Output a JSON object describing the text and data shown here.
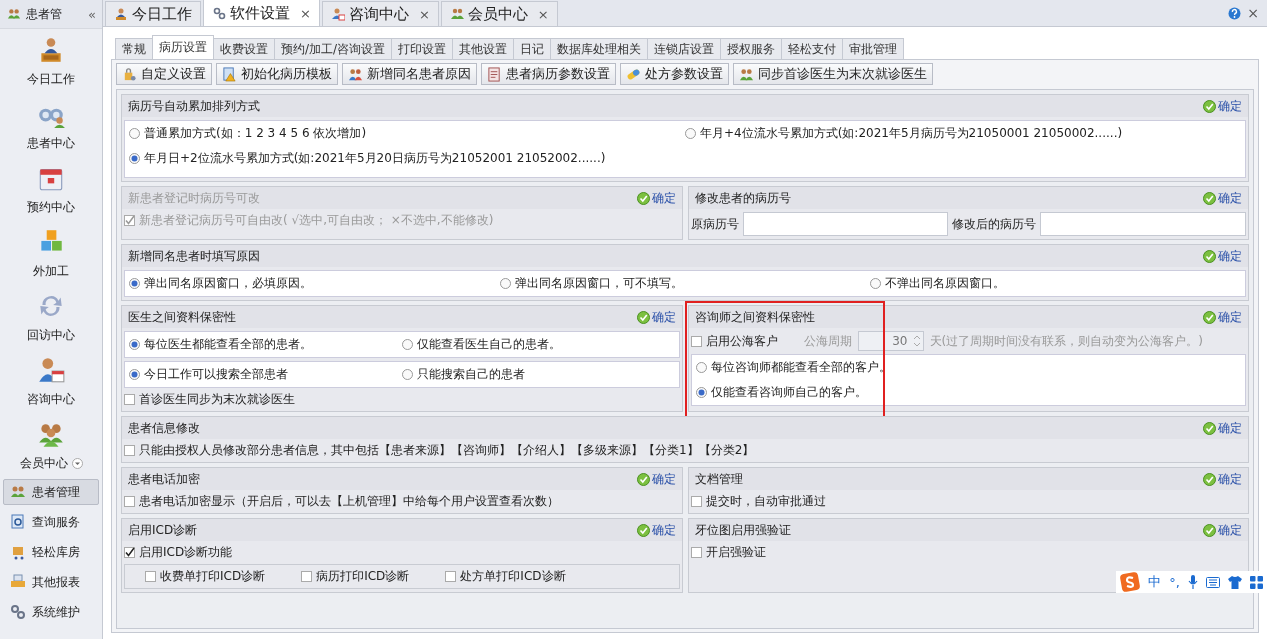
{
  "sidebar": {
    "title": "患者管",
    "collapse": "«",
    "big_items": [
      {
        "label": "今日工作",
        "kind": "plain"
      },
      {
        "label": "患者中心",
        "kind": "plain"
      },
      {
        "label": "预约中心",
        "kind": "plain"
      },
      {
        "label": "外加工",
        "kind": "plain"
      },
      {
        "label": "回访中心",
        "kind": "plain"
      },
      {
        "label": "咨询中心",
        "kind": "plain"
      },
      {
        "label": "会员中心",
        "kind": "dropdown"
      }
    ],
    "items": [
      {
        "label": "患者管理",
        "selected": true
      },
      {
        "label": "查询服务",
        "selected": false
      },
      {
        "label": "轻松库房",
        "selected": false
      },
      {
        "label": "其他报表",
        "selected": false
      },
      {
        "label": "系统维护",
        "selected": false
      }
    ]
  },
  "tabs": [
    {
      "label": "今日工作",
      "selected": false
    },
    {
      "label": "软件设置",
      "selected": true,
      "close": "×"
    },
    {
      "label": "咨询中心",
      "selected": false,
      "close": "×"
    },
    {
      "label": "会员中心",
      "selected": false,
      "close": "×"
    }
  ],
  "window_close": "×",
  "settings_tabs": [
    {
      "label": "常规",
      "selected": false
    },
    {
      "label": "病历设置",
      "selected": true
    },
    {
      "label": "收费设置",
      "selected": false
    },
    {
      "label": "预约/加工/咨询设置",
      "selected": false
    },
    {
      "label": "打印设置",
      "selected": false
    },
    {
      "label": "其他设置",
      "selected": false
    },
    {
      "label": "日记",
      "selected": false
    },
    {
      "label": "数据库处理相关",
      "selected": false
    },
    {
      "label": "连锁店设置",
      "selected": false
    },
    {
      "label": "授权服务",
      "selected": false
    },
    {
      "label": "轻松支付",
      "selected": false
    },
    {
      "label": "审批管理",
      "selected": false
    }
  ],
  "toolbar": [
    "自定义设置",
    "初始化病历模板",
    "新增同名患者原因",
    "患者病历参数设置",
    "处方参数设置",
    "同步首诊医生为末次就诊医生"
  ],
  "rows": [
    {
      "sections": [
        {
          "title": "病历号自动累加排列方式",
          "confirm": "确定",
          "disabled": false,
          "highlighted": false,
          "items": [
            {
              "kind": "radio_grid",
              "options": [
                {
                  "label": "普通累加方式(如：1 2 3 4 5 6 依次增加)",
                  "selected": false
                },
                {
                  "label": "年月+4位流水号累加方式(如:2021年5月病历号为21050001 21050002......)",
                  "selected": false
                },
                {
                  "label": "年月日+2位流水号累加方式(如:2021年5月20日病历号为21052001 21052002......)",
                  "selected": true
                }
              ]
            }
          ]
        }
      ]
    },
    {
      "sections": [
        {
          "title": "新患者登记时病历号可改",
          "confirm": "确定",
          "disabled": true,
          "highlighted": false,
          "items": [
            {
              "kind": "checkbox",
              "label": "新患者登记病历号可自由改( √选中,可自由改； ×不选中,不能修改)",
              "checked": true
            }
          ]
        },
        {
          "title": "修改患者的病历号",
          "confirm": "确定",
          "disabled": false,
          "highlighted": false,
          "items": [
            {
              "kind": "fields",
              "fields": [
                {
                  "label": "原病历号"
                },
                {
                  "label": "修改后的病历号"
                }
              ]
            }
          ]
        }
      ]
    },
    {
      "sections": [
        {
          "title": "新增同名患者时填写原因",
          "confirm": "确定",
          "disabled": false,
          "highlighted": false,
          "items": [
            {
              "kind": "radio_row",
              "options": [
                {
                  "label": "弹出同名原因窗口，必填原因。",
                  "selected": true
                },
                {
                  "label": "弹出同名原因窗口，可不填写。",
                  "selected": false
                },
                {
                  "label": "不弹出同名原因窗口。",
                  "selected": false
                }
              ]
            }
          ]
        }
      ]
    },
    {
      "sections": [
        {
          "title": "医生之间资料保密性",
          "confirm": "确定",
          "disabled": false,
          "highlighted": false,
          "items": [
            {
              "kind": "radio_row",
              "options": [
                {
                  "label": "每位医生都能查看全部的患者。",
                  "selected": true
                },
                {
                  "label": "仅能查看医生自己的患者。",
                  "selected": false
                }
              ]
            },
            {
              "kind": "radio_row",
              "options": [
                {
                  "label": "今日工作可以搜索全部患者",
                  "selected": true
                },
                {
                  "label": "只能搜索自己的患者",
                  "selected": false
                }
              ]
            },
            {
              "kind": "checkbox",
              "label": "首诊医生同步为末次就诊医生",
              "checked": false
            }
          ]
        },
        {
          "title": "咨询师之间资料保密性",
          "confirm": "确定",
          "disabled": false,
          "highlighted": true,
          "items": [
            {
              "kind": "period",
              "checkbox": {
                "label": "启用公海客户",
                "checked": false
              },
              "label": "公海周期",
              "value": "30",
              "suffix": "天(过了周期时间没有联系，则自动变为公海客户。)",
              "disabled": true
            },
            {
              "kind": "radio_stack",
              "options": [
                {
                  "label": "每位咨询师都能查看全部的客户。",
                  "selected": false
                },
                {
                  "label": "仅能查看咨询师自己的客户。",
                  "selected": true
                }
              ]
            }
          ]
        }
      ]
    },
    {
      "sections": [
        {
          "title": "患者信息修改",
          "confirm": "确定",
          "disabled": false,
          "highlighted": false,
          "items": [
            {
              "kind": "checkbox",
              "label": "只能由授权人员修改部分患者信息，其中包括【患者来源】【咨询师】【介绍人】【多级来源】【分类1】【分类2】",
              "checked": false
            }
          ]
        }
      ]
    },
    {
      "sections": [
        {
          "title": "患者电话加密",
          "confirm": "确定",
          "disabled": false,
          "highlighted": false,
          "items": [
            {
              "kind": "checkbox",
              "label": "患者电话加密显示（开启后，可以去【上机管理】中给每个用户设置查看次数）",
              "checked": false
            }
          ]
        },
        {
          "title": "文档管理",
          "confirm": "确定",
          "disabled": false,
          "highlighted": false,
          "items": [
            {
              "kind": "checkbox",
              "label": "提交时，自动审批通过",
              "checked": false
            }
          ]
        }
      ]
    },
    {
      "sections": [
        {
          "title": "启用ICD诊断",
          "confirm": "确定",
          "disabled": false,
          "highlighted": false,
          "items": [
            {
              "kind": "checkbox",
              "label": "启用ICD诊断功能",
              "checked": true
            },
            {
              "kind": "checkbox_group",
              "options": [
                {
                  "label": "收费单打印ICD诊断",
                  "checked": false
                },
                {
                  "label": "病历打印ICD诊断",
                  "checked": false
                },
                {
                  "label": "处方单打印ICD诊断",
                  "checked": false
                }
              ]
            }
          ]
        },
        {
          "title": "牙位图启用强验证",
          "confirm": "确定",
          "disabled": false,
          "highlighted": false,
          "items": [
            {
              "kind": "checkbox",
              "label": "开启强验证",
              "checked": false
            }
          ]
        }
      ]
    }
  ],
  "ime": {
    "labels": [
      "中",
      "°,"
    ]
  }
}
